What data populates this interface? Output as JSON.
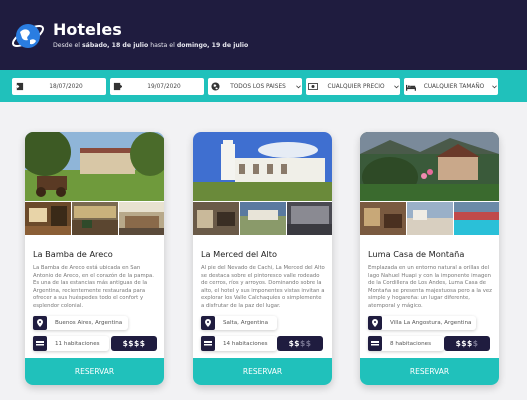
{
  "header": {
    "title": "Hoteles",
    "subtitle_prefix": "Desde el",
    "date_from": "sábado, 18 de julio",
    "subtitle_mid": "hasta el",
    "date_to": "domingo, 19 de julio"
  },
  "filters": {
    "date_from": "18/07/2020",
    "date_to": "19/07/2020",
    "country": "TODOS LOS PAISES",
    "price": "CUALQUIER PRECIO",
    "size": "CUALQUIER TAMAÑO"
  },
  "hotels": [
    {
      "name": "La Bamba de Areco",
      "description": "La Bamba de Areco está ubicada en San Antonio de Areco, en el corazón de la pampa. Es una de las estancias más antiguas de la Argentina, recientemente restaurada para ofrecer a sus huéspedes todo el confort y esplendor colonial.",
      "location": "Buenos Aires, Argentina",
      "rooms": "11 habitaciones",
      "price_active": "$$$$",
      "price_dim": "",
      "reserve_label": "RESERVAR"
    },
    {
      "name": "La Merced del Alto",
      "description": "Al pie del Nevado de Cachi, La Merced del Alto se destaca sobre el pintoresco valle rodeado de cerros, ríos y arroyos. Dominando sobre la alto, el hotel y sus imponentes vistas invitan a explorar los Valle Calchaquíes o simplemente a disfrutar de la paz del lugar.",
      "location": "Salta, Argentina",
      "rooms": "14 habitaciones",
      "price_active": "$$",
      "price_dim": "$$",
      "reserve_label": "RESERVAR"
    },
    {
      "name": "Luma Casa de Montaña",
      "description": "Emplazada en un entorno natural a orillas del lago Nahuel Huapi y con la imponente imagen de la Cordillera de Los Andes, Luma Casa de Montaña se presenta majestuosa pero a la vez simple y hogareña: un lugar diferente, atemporal y mágico.",
      "location": "Villa La Angostura, Argentina",
      "rooms": "8 habitaciones",
      "price_active": "$$$",
      "price_dim": "$",
      "reserve_label": "RESERVAR"
    }
  ],
  "colors": {
    "navy": "#1f1c3f",
    "teal": "#20c1bb",
    "logo_blue": "#2a7de1"
  },
  "icons": [
    "globe-hotel-logo",
    "calendar-in-icon",
    "calendar-out-icon",
    "globe-icon",
    "money-icon",
    "bed-icon",
    "chevron-down-icon",
    "location-pin-icon",
    "size-icon"
  ]
}
